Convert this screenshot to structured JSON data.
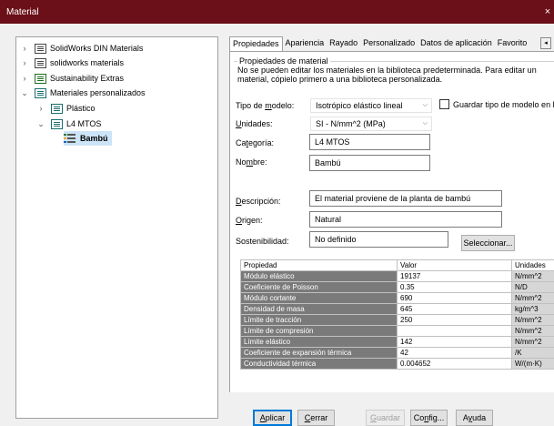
{
  "window": {
    "title": "Material",
    "close_glyph": "×"
  },
  "tree": {
    "items": [
      {
        "label": "SolidWorks DIN Materials",
        "icon": "library-icon"
      },
      {
        "label": "solidworks materials",
        "icon": "library-icon"
      },
      {
        "label": "Sustainability Extras",
        "icon": "library-green-icon"
      },
      {
        "label": "Materiales personalizados",
        "icon": "library-teal-icon"
      },
      {
        "label": "Plástico",
        "icon": "folder-teal-icon"
      },
      {
        "label": "L4 MTOS",
        "icon": "folder-teal-icon"
      },
      {
        "label": "Bambú",
        "icon": "material-icon"
      }
    ]
  },
  "tabs": [
    "Propiedades",
    "Apariencia",
    "Rayado",
    "Personalizado",
    "Datos de aplicación",
    "Favorito"
  ],
  "tab_scroll_glyph": "◂",
  "panel": {
    "group_title": "Propiedades de material",
    "notice": "No se pueden editar los materiales en la biblioteca predeterminada. Para editar un material, cópielo primero a una biblioteca personalizada.",
    "model_type_label": "Tipo de modelo:",
    "model_type_value": "Isotrópico elástico lineal",
    "save_model_type_label": "Guardar tipo de modelo en la",
    "units_label": "Unidades:",
    "units_value": "SI - N/mm^2 (MPa)",
    "category_label": "Categoría:",
    "category_value": "L4 MTOS",
    "name_label": "Nombre:",
    "name_value": "Bambú",
    "description_label": "Descripción:",
    "description_value": "El material proviene de la planta de bambú",
    "origin_label": "Origen:",
    "origin_value": "Natural",
    "sustainability_label": "Sostenibilidad:",
    "sustainability_value": "No definido",
    "select_button": "Seleccionar..."
  },
  "table": {
    "headers": [
      "Propiedad",
      "Valor",
      "Unidades"
    ],
    "rows": [
      [
        "Módulo elástico",
        "19137",
        "N/mm^2"
      ],
      [
        "Coeficiente de Poisson",
        "0.35",
        "N/D"
      ],
      [
        "Módulo cortante",
        "690",
        "N/mm^2"
      ],
      [
        "Densidad de masa",
        "645",
        "kg/m^3"
      ],
      [
        "Límite de tracción",
        "250",
        "N/mm^2"
      ],
      [
        "Límite de compresión",
        "",
        "N/mm^2"
      ],
      [
        "Límite elástico",
        "142",
        "N/mm^2"
      ],
      [
        "Coeficiente de expansión térmica",
        "42",
        "/K"
      ],
      [
        "Conductividad térmica",
        "0.004652",
        "W/(m·K)"
      ]
    ]
  },
  "buttons": {
    "apply": "Aplicar",
    "close": "Cerrar",
    "save": "Guardar",
    "config": "Config...",
    "help": "Ayuda"
  },
  "colors": {
    "titlebar": "#6b1018",
    "selection": "#cce4f7",
    "property_cell": "#7a7a7a"
  }
}
